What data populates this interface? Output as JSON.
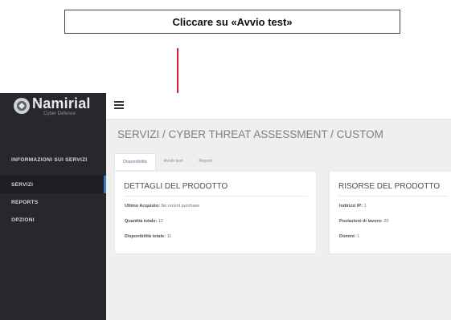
{
  "callout": {
    "text": "Cliccare su «Avvio test»"
  },
  "brand": {
    "name": "Namirial",
    "tagline": "Cyber Defence"
  },
  "sidebar": {
    "items": [
      {
        "label": "INFORMAZIONI SUI SERVIZI"
      },
      {
        "label": "SERVIZI",
        "active": true
      },
      {
        "label": "REPORTS"
      },
      {
        "label": "OPZIONI"
      }
    ]
  },
  "header": {
    "menu_icon": "hamburger-icon"
  },
  "breadcrumb": "SERVIZI / CYBER THREAT ASSESSMENT / CUSTOM",
  "tabs": [
    {
      "label": "Disponibilità",
      "active": true
    },
    {
      "label": "Avvio test"
    },
    {
      "label": "Report"
    }
  ],
  "product_details": {
    "title": "DETTAGLI DEL PRODOTTO",
    "last_purchase_label": "Ultimo Acquisto:",
    "last_purchase_value": "No recent purchase",
    "total_qty_label": "Quantità totale:",
    "total_qty_value": "12",
    "total_avail_label": "Disponibilità totale:",
    "total_avail_value": "11"
  },
  "product_resources": {
    "title": "RISORSE DEL PRODOTTO",
    "ip_label": "Indirizzi IP:",
    "ip_value": "1",
    "workstations_label": "Postazioni di lavoro:",
    "workstations_value": "20",
    "domains_label": "Domini:",
    "domains_value": "1"
  },
  "colors": {
    "sidebar_bg": "#26282b",
    "arrow": "#d9202a",
    "content_bg": "#efefef",
    "active_indicator": "#3a78c2"
  }
}
